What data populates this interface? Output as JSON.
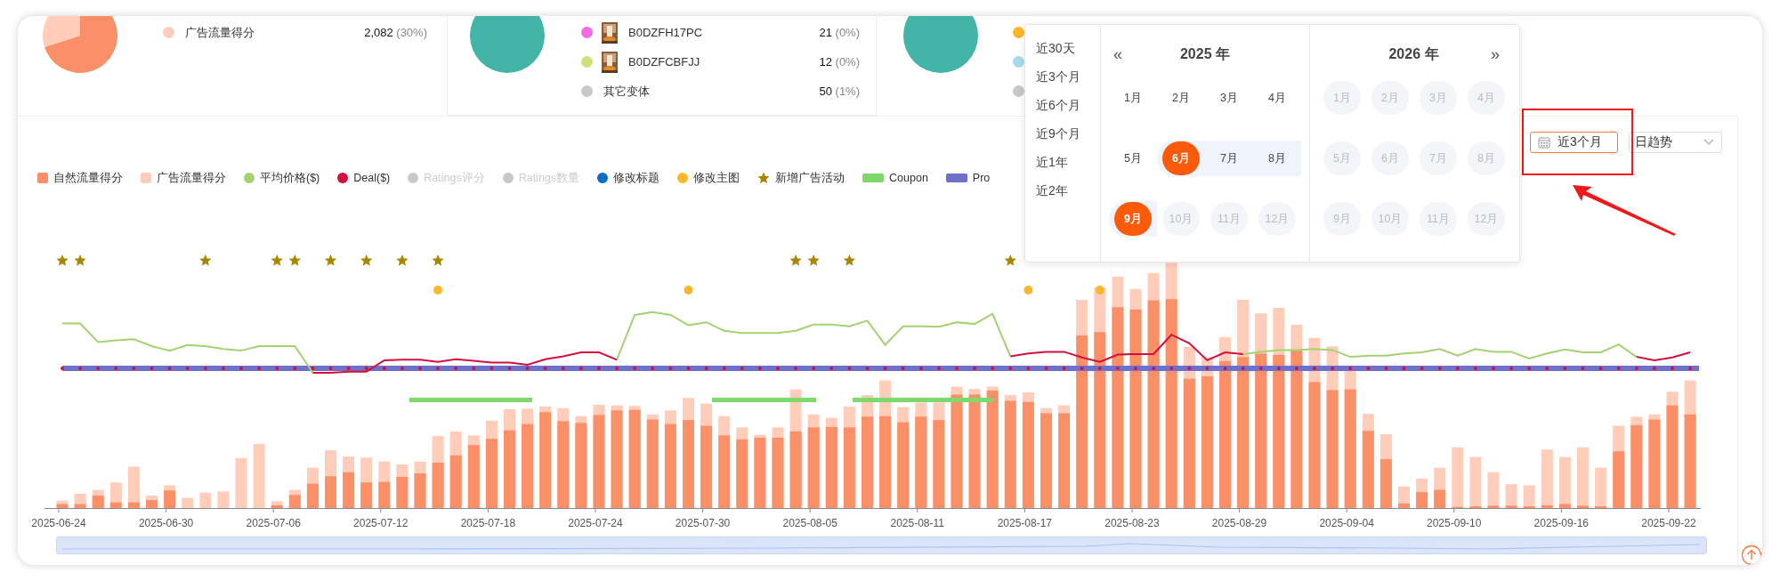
{
  "summary_panels": [
    {
      "rows": [
        {
          "label": "广告流量得分",
          "value": "2,082",
          "share": "(30%)",
          "color": "#ffcdb9",
          "kind": "metric"
        }
      ]
    },
    {
      "rows": [
        {
          "label": "B0DZFH17PC",
          "value": "21",
          "share": "(0%)",
          "color": "#f06ce6",
          "kind": "product"
        },
        {
          "label": "B0DZFCBFJJ",
          "value": "12",
          "share": "(0%)",
          "color": "#cfe07a",
          "kind": "product"
        },
        {
          "label": "其它变体",
          "value": "50",
          "share": "(1%)",
          "color": "#c8c8c8",
          "kind": "metric"
        }
      ]
    },
    {
      "rows": [
        {
          "color": "#fbb829",
          "kind": "covered"
        },
        {
          "color": "#a6dcea",
          "kind": "covered"
        },
        {
          "color": "#c8c8c8",
          "kind": "covered"
        }
      ]
    }
  ],
  "date_field": {
    "value": "近3个月"
  },
  "granularity_select": {
    "value": "日趋势"
  },
  "legend": [
    {
      "label": "自然流量得分",
      "kind": "rect",
      "color": "#fb8f68",
      "active": true
    },
    {
      "label": "广告流量得分",
      "kind": "rect",
      "color": "#ffcdb9",
      "active": true
    },
    {
      "label": "平均价格($)",
      "kind": "circle",
      "color": "#a3d270",
      "active": true
    },
    {
      "label": "Deal($)",
      "kind": "circle",
      "color": "#d2103c",
      "active": true
    },
    {
      "label": "Ratings评分",
      "kind": "circle",
      "color": "#c8c8c8",
      "active": false
    },
    {
      "label": "Ratings数量",
      "kind": "circle",
      "color": "#c8c8c8",
      "active": false
    },
    {
      "label": "修改标题",
      "kind": "circle",
      "color": "#0a6ebd",
      "active": true
    },
    {
      "label": "修改主图",
      "kind": "circle",
      "color": "#fbb829",
      "active": true
    },
    {
      "label": "新增广告活动",
      "kind": "star",
      "color": "#a88600",
      "active": true
    },
    {
      "label": "Coupon",
      "kind": "bar",
      "color": "#7fd96a",
      "active": true
    },
    {
      "label": "Pro",
      "kind": "bar",
      "color": "#6e70cc",
      "active": true
    }
  ],
  "x_axis": {
    "labels": [
      "2025-06-24",
      "2025-06-30",
      "2025-07-06",
      "2025-07-12",
      "2025-07-18",
      "2025-07-24",
      "2025-07-30",
      "2025-08-05",
      "2025-08-11",
      "2025-08-17",
      "2025-08-23",
      "2025-08-29",
      "2025-09-04",
      "2025-09-10",
      "2025-09-16",
      "2025-09-22"
    ]
  },
  "date_picker": {
    "shortcuts": [
      "近30天",
      "近3个月",
      "近6个月",
      "近9个月",
      "近1年",
      "近2年"
    ],
    "panels": [
      {
        "year": "2025 年",
        "nav": "«",
        "months": [
          {
            "label": "1月",
            "selected": false,
            "in_range": false,
            "disabled": false
          },
          {
            "label": "2月",
            "selected": false,
            "in_range": false,
            "disabled": false
          },
          {
            "label": "3月",
            "selected": false,
            "in_range": false,
            "disabled": false
          },
          {
            "label": "4月",
            "selected": false,
            "in_range": false,
            "disabled": false
          },
          {
            "label": "5月",
            "selected": false,
            "in_range": false,
            "disabled": false
          },
          {
            "label": "6月",
            "selected": true,
            "in_range": true,
            "disabled": false
          },
          {
            "label": "7月",
            "selected": false,
            "in_range": true,
            "disabled": false
          },
          {
            "label": "8月",
            "selected": false,
            "in_range": true,
            "disabled": false
          },
          {
            "label": "9月",
            "selected": true,
            "in_range": true,
            "disabled": false
          },
          {
            "label": "10月",
            "selected": false,
            "in_range": false,
            "disabled": true
          },
          {
            "label": "11月",
            "selected": false,
            "in_range": false,
            "disabled": true
          },
          {
            "label": "12月",
            "selected": false,
            "in_range": false,
            "disabled": true
          }
        ]
      },
      {
        "year": "2026 年",
        "nav": "»",
        "months": [
          {
            "label": "1月",
            "selected": false,
            "in_range": false,
            "disabled": true
          },
          {
            "label": "2月",
            "selected": false,
            "in_range": false,
            "disabled": true
          },
          {
            "label": "3月",
            "selected": false,
            "in_range": false,
            "disabled": true
          },
          {
            "label": "4月",
            "selected": false,
            "in_range": false,
            "disabled": true
          },
          {
            "label": "5月",
            "selected": false,
            "in_range": false,
            "disabled": true
          },
          {
            "label": "6月",
            "selected": false,
            "in_range": false,
            "disabled": true
          },
          {
            "label": "7月",
            "selected": false,
            "in_range": false,
            "disabled": true
          },
          {
            "label": "8月",
            "selected": false,
            "in_range": false,
            "disabled": true
          },
          {
            "label": "9月",
            "selected": false,
            "in_range": false,
            "disabled": true
          },
          {
            "label": "10月",
            "selected": false,
            "in_range": false,
            "disabled": true
          },
          {
            "label": "11月",
            "selected": false,
            "in_range": false,
            "disabled": true
          },
          {
            "label": "12月",
            "selected": false,
            "in_range": false,
            "disabled": true
          }
        ]
      }
    ]
  }
}
